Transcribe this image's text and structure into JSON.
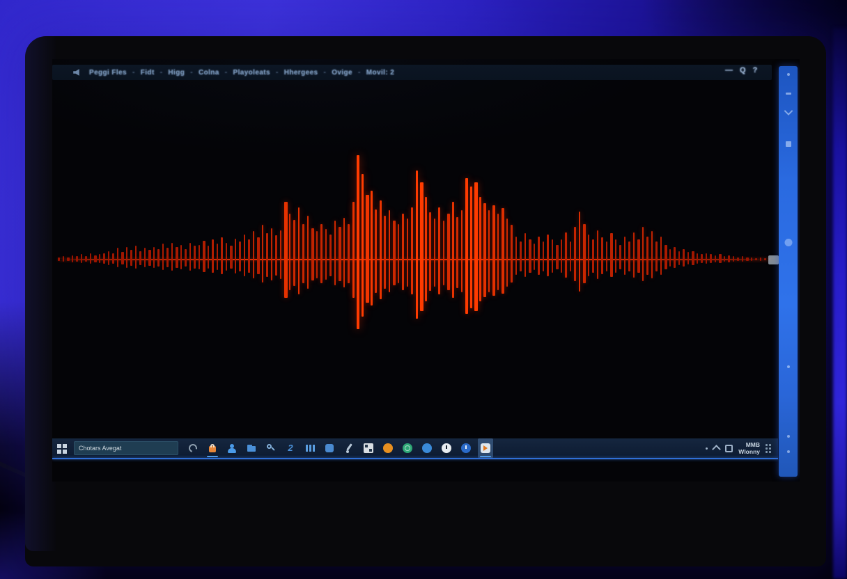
{
  "colors": {
    "wall_blue": "#3b30d8",
    "bezel": "#08080b",
    "screen": "#040407",
    "waveform_bright": "#ff3a08",
    "waveform_dim": "#8c1600",
    "scroll_strip": "#2a6ae0",
    "taskbar_bg": "#0d1b31",
    "taskbar_accent": "#2f6fd6"
  },
  "app": {
    "menu_bar": {
      "separator": "-",
      "items": [
        "Peggi Fles",
        "Fidt",
        "Higg",
        "Colna",
        "Playoleats",
        "Hhergees",
        "Ovige",
        "Movil: 2"
      ]
    },
    "window_controls": [
      {
        "name": "minimize-icon",
        "glyph": "—"
      },
      {
        "name": "zoom-icon",
        "glyph": "Q"
      },
      {
        "name": "help-icon",
        "glyph": "?"
      }
    ]
  },
  "waveform": {
    "samples": [
      0.02,
      0.03,
      0.02,
      0.04,
      0.03,
      0.05,
      0.03,
      0.06,
      0.04,
      0.05,
      0.06,
      0.08,
      0.06,
      0.11,
      0.07,
      0.12,
      0.09,
      0.13,
      0.08,
      0.11,
      0.09,
      0.12,
      0.1,
      0.15,
      0.11,
      0.16,
      0.12,
      0.14,
      0.1,
      0.16,
      0.13,
      0.14,
      0.18,
      0.13,
      0.19,
      0.15,
      0.21,
      0.16,
      0.13,
      0.2,
      0.17,
      0.24,
      0.19,
      0.27,
      0.21,
      0.33,
      0.25,
      0.3,
      0.23,
      0.28,
      0.55,
      0.44,
      0.38,
      0.5,
      0.34,
      0.42,
      0.3,
      0.27,
      0.34,
      0.29,
      0.24,
      0.37,
      0.31,
      0.4,
      0.34,
      0.55,
      1.0,
      0.82,
      0.62,
      0.66,
      0.48,
      0.57,
      0.42,
      0.47,
      0.37,
      0.34,
      0.44,
      0.39,
      0.5,
      0.85,
      0.74,
      0.6,
      0.45,
      0.39,
      0.5,
      0.37,
      0.44,
      0.55,
      0.41,
      0.47,
      0.78,
      0.7,
      0.74,
      0.6,
      0.54,
      0.47,
      0.52,
      0.44,
      0.49,
      0.39,
      0.33,
      0.22,
      0.17,
      0.25,
      0.19,
      0.15,
      0.22,
      0.17,
      0.24,
      0.19,
      0.14,
      0.19,
      0.26,
      0.17,
      0.31,
      0.46,
      0.34,
      0.24,
      0.19,
      0.28,
      0.21,
      0.17,
      0.25,
      0.19,
      0.14,
      0.22,
      0.17,
      0.26,
      0.19,
      0.31,
      0.22,
      0.27,
      0.17,
      0.22,
      0.14,
      0.1,
      0.12,
      0.08,
      0.1,
      0.07,
      0.08,
      0.06,
      0.05,
      0.06,
      0.05,
      0.04,
      0.05,
      0.03,
      0.04,
      0.03,
      0.02,
      0.03,
      0.02,
      0.02,
      0.01,
      0.02,
      0.01,
      0.01
    ]
  },
  "taskbar": {
    "search_value": "Chotars Avegat",
    "icons": [
      {
        "name": "cortana-icon",
        "shape": "cortana",
        "color": "#8fa0b0"
      },
      {
        "name": "store-bag-icon",
        "shape": "bag",
        "color": "#e8873a",
        "underline": true
      },
      {
        "name": "people-icon",
        "shape": "person",
        "color": "#4a9ae8"
      },
      {
        "name": "folder-icon",
        "shape": "folder",
        "color": "#4a90d8"
      },
      {
        "name": "search-app-icon",
        "shape": "magnifier",
        "color": "#85b2dd"
      },
      {
        "name": "swoosh-icon",
        "shape": "swoosh",
        "color": "#4a90d8",
        "glyph": "2"
      },
      {
        "name": "columns-icon",
        "shape": "columns",
        "color": "#5a9ee0"
      },
      {
        "name": "panel-icon",
        "shape": "square",
        "color": "#4a8ad0"
      },
      {
        "name": "pin-icon",
        "shape": "pin",
        "color": "#b8c8d8"
      },
      {
        "name": "photos-icon",
        "shape": "checker",
        "color": "#d8dde2"
      },
      {
        "name": "browser-orange-icon",
        "shape": "circle",
        "color": "#e89020"
      },
      {
        "name": "globe-icon",
        "shape": "globe",
        "color": "#2ea876"
      },
      {
        "name": "blue-circle-icon",
        "shape": "circle",
        "color": "#3a8ad8"
      },
      {
        "name": "clock-light-icon",
        "shape": "clock-light",
        "color": "#e8ecf0"
      },
      {
        "name": "clock-blue-icon",
        "shape": "clock-dark",
        "color": "#2a6ac8"
      },
      {
        "name": "active-app-icon",
        "shape": "media",
        "color": "#dce6ee",
        "active": true
      }
    ],
    "tray": {
      "clock_line1": "MMB",
      "clock_line2": "Wlonny"
    }
  }
}
